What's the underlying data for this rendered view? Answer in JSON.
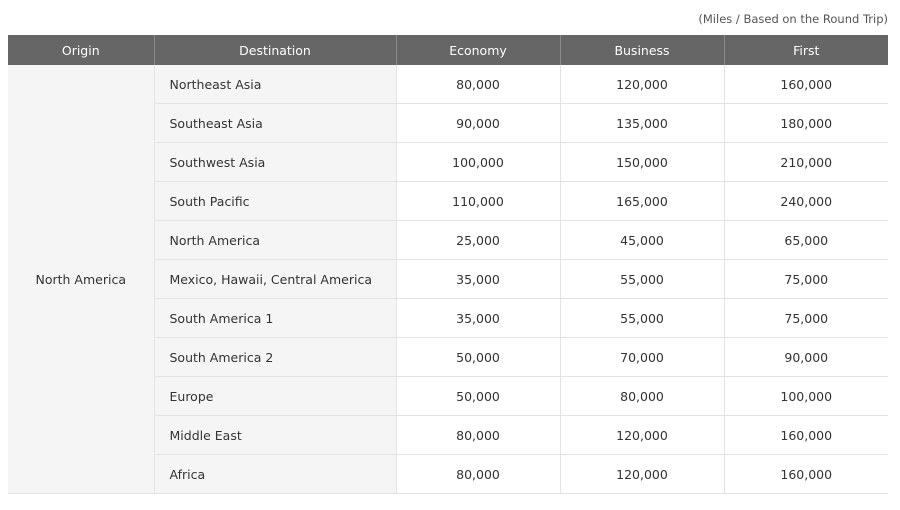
{
  "note": "(Miles / Based on the Round Trip)",
  "headers": {
    "origin": "Origin",
    "destination": "Destination",
    "economy": "Economy",
    "business": "Business",
    "first": "First"
  },
  "origin": "North America",
  "rows": [
    {
      "destination": "Northeast Asia",
      "economy": "80,000",
      "business": "120,000",
      "first": "160,000"
    },
    {
      "destination": "Southeast Asia",
      "economy": "90,000",
      "business": "135,000",
      "first": "180,000"
    },
    {
      "destination": "Southwest Asia",
      "economy": "100,000",
      "business": "150,000",
      "first": "210,000"
    },
    {
      "destination": "South Pacific",
      "economy": "110,000",
      "business": "165,000",
      "first": "240,000"
    },
    {
      "destination": "North America",
      "economy": "25,000",
      "business": "45,000",
      "first": "65,000"
    },
    {
      "destination": "Mexico, Hawaii, Central America",
      "economy": "35,000",
      "business": "55,000",
      "first": "75,000"
    },
    {
      "destination": "South America 1",
      "economy": "35,000",
      "business": "55,000",
      "first": "75,000"
    },
    {
      "destination": "South America 2",
      "economy": "50,000",
      "business": "70,000",
      "first": "90,000"
    },
    {
      "destination": "Europe",
      "economy": "50,000",
      "business": "80,000",
      "first": "100,000"
    },
    {
      "destination": "Middle East",
      "economy": "80,000",
      "business": "120,000",
      "first": "160,000"
    },
    {
      "destination": "Africa",
      "economy": "80,000",
      "business": "120,000",
      "first": "160,000"
    }
  ]
}
